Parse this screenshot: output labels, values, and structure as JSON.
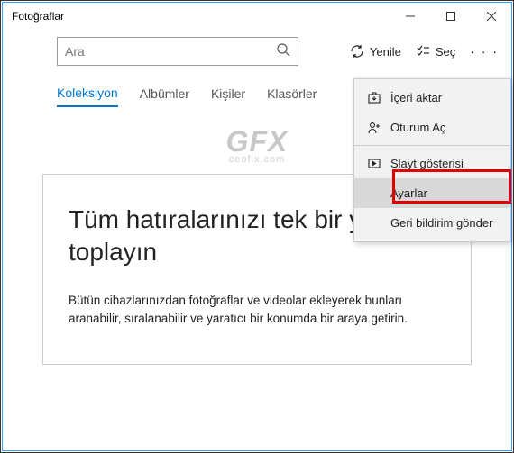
{
  "window": {
    "title": "Fotoğraflar"
  },
  "toolbar": {
    "search_placeholder": "Ara",
    "refresh_label": "Yenile",
    "select_label": "Seç"
  },
  "tabs": {
    "collection": "Koleksiyon",
    "albums": "Albümler",
    "people": "Kişiler",
    "folders": "Klasörler"
  },
  "watermark": {
    "logo": "GFX",
    "url": "ceofix.com"
  },
  "hero": {
    "title": "Tüm hatıralarınızı tek bir yerde toplayın",
    "subtitle": "Bütün cihazlarınızdan fotoğraflar ve videolar ekleyerek bunları aranabilir, sıralanabilir ve yaratıcı bir konumda bir araya getirin."
  },
  "menu": {
    "import": "İçeri aktar",
    "signin": "Oturum Aç",
    "slideshow": "Slayt gösterisi",
    "settings": "Ayarlar",
    "feedback": "Geri bildirim gönder"
  }
}
